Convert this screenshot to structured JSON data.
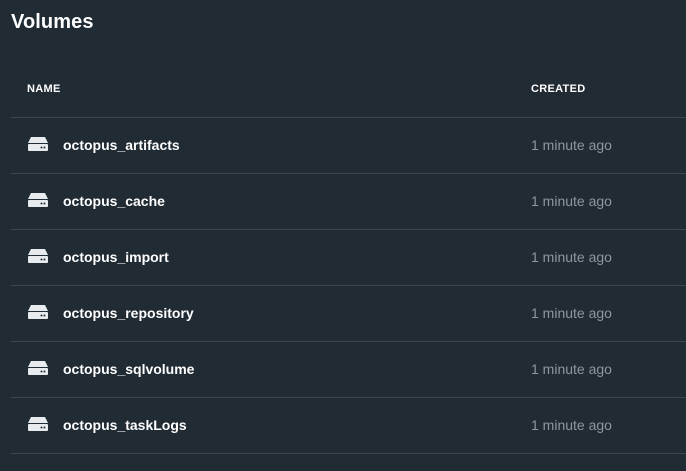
{
  "page": {
    "title": "Volumes"
  },
  "table": {
    "columns": {
      "name": "NAME",
      "created": "CREATED"
    },
    "rows": [
      {
        "name": "octopus_artifacts",
        "created": "1 minute ago",
        "icon": "volume-icon"
      },
      {
        "name": "octopus_cache",
        "created": "1 minute ago",
        "icon": "volume-icon"
      },
      {
        "name": "octopus_import",
        "created": "1 minute ago",
        "icon": "volume-icon"
      },
      {
        "name": "octopus_repository",
        "created": "1 minute ago",
        "icon": "volume-icon"
      },
      {
        "name": "octopus_sqlvolume",
        "created": "1 minute ago",
        "icon": "volume-icon"
      },
      {
        "name": "octopus_taskLogs",
        "created": "1 minute ago",
        "icon": "volume-icon"
      }
    ]
  },
  "colors": {
    "background": "#212b33",
    "divider": "#3a4650",
    "text_primary": "#ffffff",
    "text_secondary": "#8e979e"
  }
}
